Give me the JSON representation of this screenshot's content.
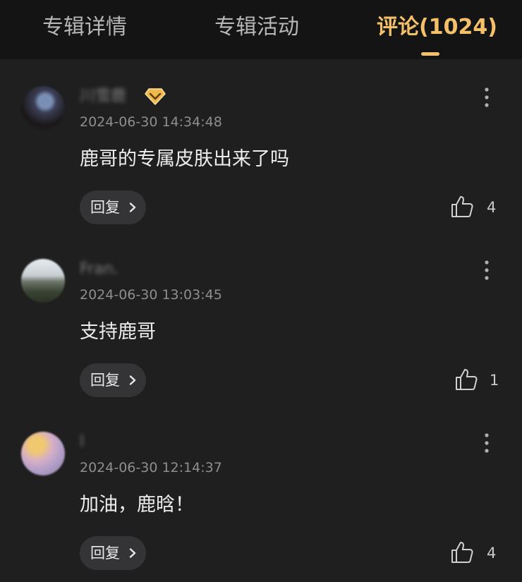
{
  "tabs": [
    {
      "label": "专辑详情",
      "active": false
    },
    {
      "label": "专辑活动",
      "active": false
    },
    {
      "label": "评论(1024)",
      "active": true
    }
  ],
  "colors": {
    "background": "#1f1f20",
    "tabbar": "#141414",
    "accent": "#f5c06a",
    "text_primary": "#ededed",
    "text_secondary": "#8e8e8e",
    "button_bg": "#343436"
  },
  "comments": [
    {
      "username": "川雪鹿",
      "vip_badge": "gold-diamond-icon",
      "timestamp": "2024-06-30 14:34:48",
      "text": "鹿哥的专属皮肤出来了吗",
      "reply_label": "回复",
      "likes": "4"
    },
    {
      "username": "Fran.",
      "timestamp": "2024-06-30 13:03:45",
      "text": "支持鹿哥",
      "reply_label": "回复",
      "likes": "1"
    },
    {
      "username": "l",
      "timestamp": "2024-06-30 12:14:37",
      "text": "加油，鹿晗！",
      "reply_label": "回复",
      "likes": "4"
    }
  ]
}
